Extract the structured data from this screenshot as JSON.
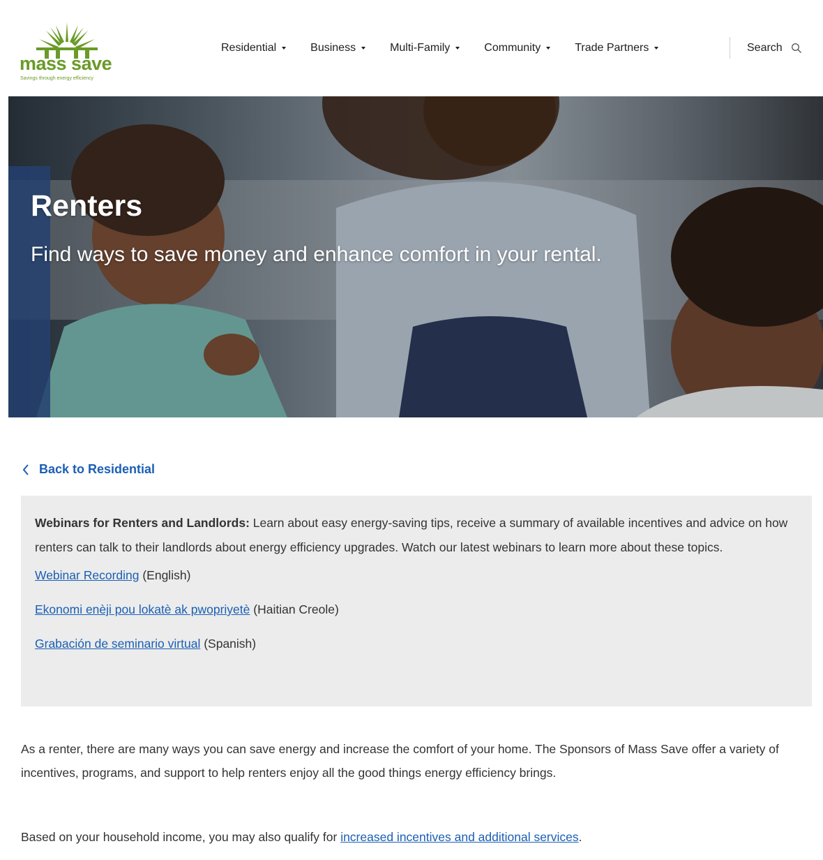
{
  "header": {
    "logo_text": "mass save",
    "logo_tagline": "Savings through energy efficiency",
    "nav": [
      "Residential",
      "Business",
      "Multi-Family",
      "Community",
      "Trade Partners"
    ],
    "search_label": "Search"
  },
  "hero": {
    "title": "Renters",
    "subtitle": "Find ways to save money and enhance comfort in your rental."
  },
  "back_link": "Back to Residential",
  "webinar": {
    "heading": "Webinars for Renters and Landlords:",
    "text": " Learn about easy energy-saving tips, receive a summary of available incentives and advice on how renters can talk to their landlords about energy efficiency upgrades. Watch our latest webinars to learn more about these topics.",
    "links": [
      {
        "label": "Webinar Recording",
        "lang": " (English)"
      },
      {
        "label": "Ekonomi enèji pou lokatè ak pwopriyetè",
        "lang": " (Haitian Creole)"
      },
      {
        "label": "Grabación de seminario virtual",
        "lang": " (Spanish)"
      }
    ]
  },
  "body": {
    "para1": "As a renter, there are many ways you can save energy and increase the comfort of your home. The Sponsors of Mass Save offer a variety of incentives, programs, and support to help renters enjoy all the good things energy efficiency brings.",
    "para2_prefix": "Based on your household income, you may also qualify for ",
    "para2_link": "increased incentives and additional services",
    "para2_suffix": "."
  },
  "colors": {
    "brand_green": "#6a9a28",
    "link_blue": "#1a5fb4",
    "panel_gray": "#ececec"
  }
}
